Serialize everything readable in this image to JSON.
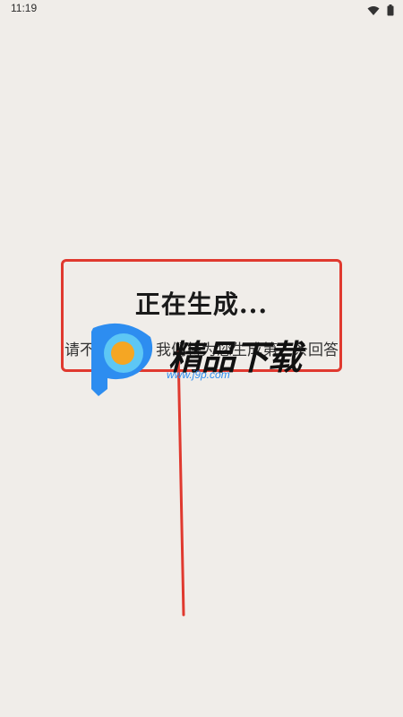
{
  "status_bar": {
    "time": "11:19",
    "icons": [
      "wifi-icon",
      "battery-icon"
    ]
  },
  "dialog": {
    "title": "正在生成...",
    "hint": "请不要离开，我们将为您生成第一条回答"
  },
  "watermark": {
    "brand": "精品下载",
    "url": "www.j9p.com"
  },
  "colors": {
    "background": "#f0ede9",
    "highlight": "#e0392f",
    "logo_blue": "#2d8df0",
    "logo_orange": "#f5a623"
  }
}
